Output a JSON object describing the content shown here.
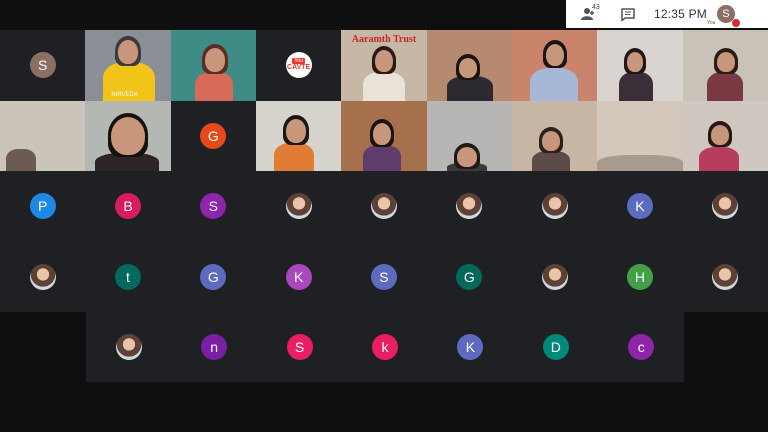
{
  "topbar": {
    "participant_count": "43",
    "time": "12:35 PM",
    "self_initial": "S",
    "self_label": "You"
  },
  "colors": {
    "tile_bg": "#1f2023",
    "page_bg": "#0f0f10"
  },
  "rows": [
    [
      {
        "kind": "avatar",
        "initial": "S",
        "color": "#8d6e63"
      },
      {
        "kind": "video",
        "scene": "yellow-man",
        "name": "NIRVEDA"
      },
      {
        "kind": "video",
        "scene": "teal-woman"
      },
      {
        "kind": "youtube",
        "label": "CAVTE"
      },
      {
        "kind": "video",
        "scene": "banner-woman",
        "banner": "Aaramth Trust"
      },
      {
        "kind": "video",
        "scene": "dark-woman"
      },
      {
        "kind": "video",
        "scene": "man-glasses"
      },
      {
        "kind": "video",
        "scene": "stairs-girl"
      },
      {
        "kind": "video",
        "scene": "white-woman"
      }
    ],
    [
      {
        "kind": "video",
        "scene": "room-door"
      },
      {
        "kind": "video",
        "scene": "closeup-woman"
      },
      {
        "kind": "avatar",
        "initial": "G",
        "color": "#e64a19"
      },
      {
        "kind": "video",
        "scene": "orange-woman"
      },
      {
        "kind": "video",
        "scene": "woman-beige"
      },
      {
        "kind": "video",
        "scene": "man-top"
      },
      {
        "kind": "video",
        "scene": "woman-hat"
      },
      {
        "kind": "video",
        "scene": "empty-wall"
      },
      {
        "kind": "video",
        "scene": "woman-window"
      }
    ],
    [
      {
        "kind": "avatar",
        "initial": "P",
        "color": "#1e88e5"
      },
      {
        "kind": "avatar",
        "initial": "B",
        "color": "#d81b60"
      },
      {
        "kind": "avatar",
        "initial": "S",
        "color": "#8e24aa"
      },
      {
        "kind": "photo"
      },
      {
        "kind": "photo"
      },
      {
        "kind": "photo"
      },
      {
        "kind": "photo"
      },
      {
        "kind": "avatar",
        "initial": "K",
        "color": "#5c6bc0"
      },
      {
        "kind": "photo"
      }
    ],
    [
      {
        "kind": "photo"
      },
      {
        "kind": "avatar",
        "initial": "t",
        "color": "#00695c"
      },
      {
        "kind": "avatar",
        "initial": "G",
        "color": "#5c6bc0"
      },
      {
        "kind": "avatar",
        "initial": "K",
        "color": "#ab47bc"
      },
      {
        "kind": "avatar",
        "initial": "S",
        "color": "#5c6bc0"
      },
      {
        "kind": "avatar",
        "initial": "G",
        "color": "#00695c"
      },
      {
        "kind": "photo"
      },
      {
        "kind": "avatar",
        "initial": "H",
        "color": "#43a047"
      },
      {
        "kind": "photo"
      }
    ]
  ],
  "last_row": [
    {
      "kind": "photo"
    },
    {
      "kind": "avatar",
      "initial": "n",
      "color": "#7b1fa2"
    },
    {
      "kind": "avatar",
      "initial": "S",
      "color": "#e91e63"
    },
    {
      "kind": "avatar",
      "initial": "k",
      "color": "#e91e63"
    },
    {
      "kind": "avatar",
      "initial": "K",
      "color": "#5c6bc0"
    },
    {
      "kind": "avatar",
      "initial": "D",
      "color": "#00897b"
    },
    {
      "kind": "avatar",
      "initial": "c",
      "color": "#8e24aa"
    }
  ]
}
